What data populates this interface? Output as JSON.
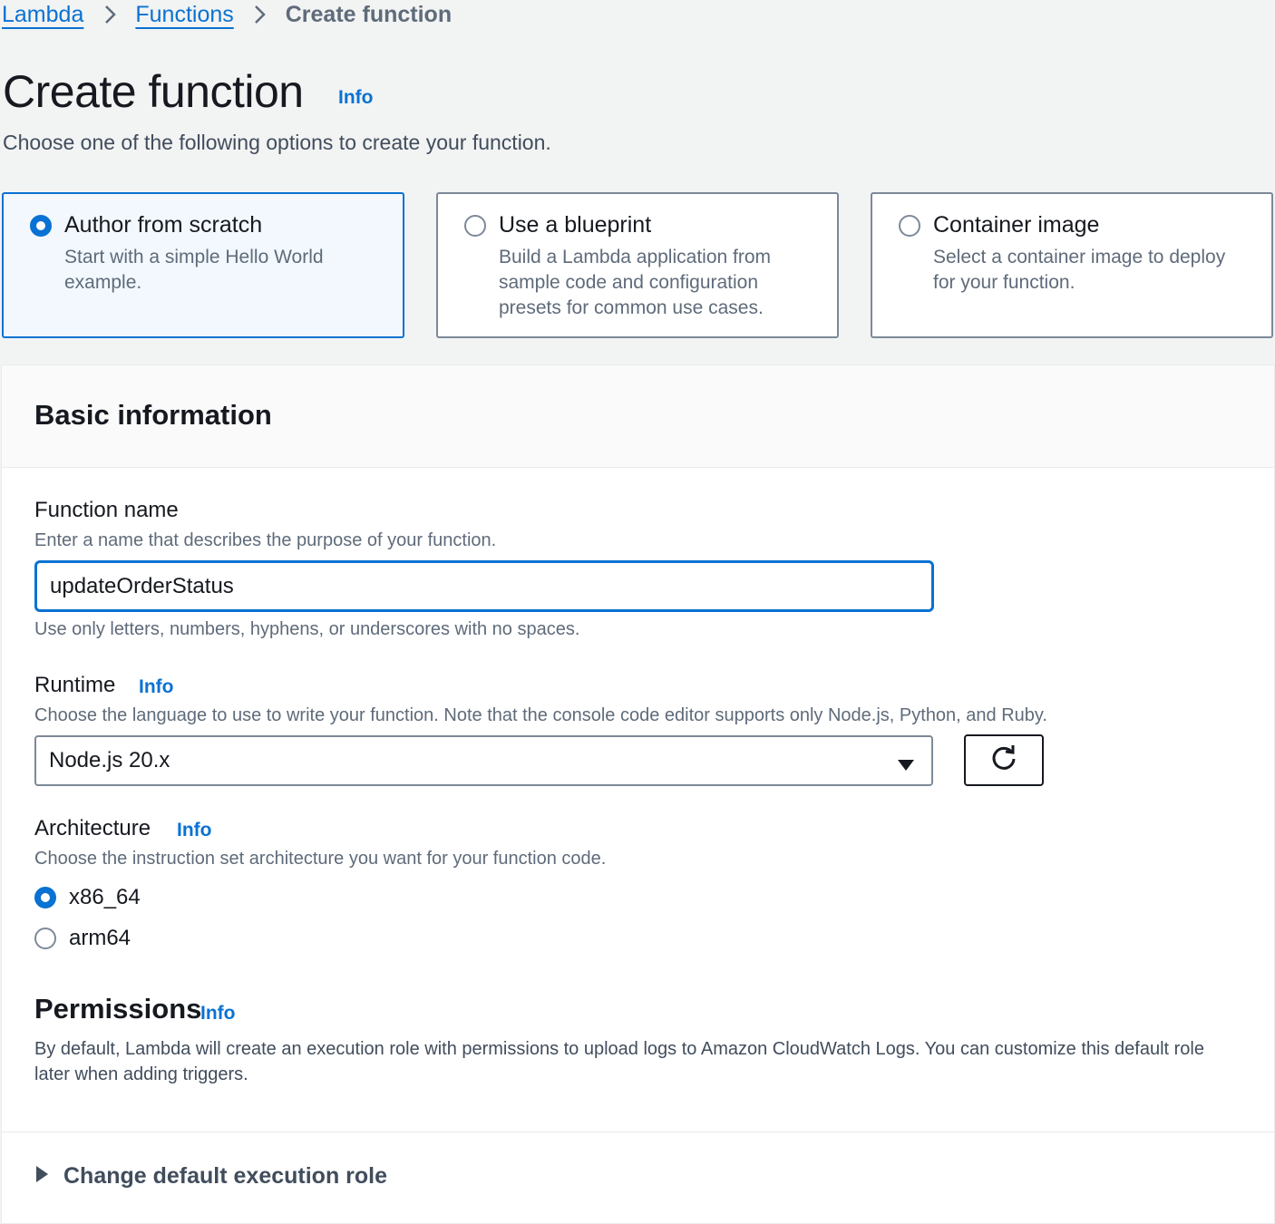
{
  "breadcrumb": {
    "items": [
      {
        "label": "Lambda"
      },
      {
        "label": "Functions"
      }
    ],
    "current": "Create function"
  },
  "page": {
    "title": "Create function",
    "info_label": "Info",
    "description": "Choose one of the following options to create your function."
  },
  "options": [
    {
      "title": "Author from scratch",
      "description": "Start with a simple Hello World example.",
      "selected": true
    },
    {
      "title": "Use a blueprint",
      "description": "Build a Lambda application from sample code and configuration presets for common use cases.",
      "selected": false
    },
    {
      "title": "Container image",
      "description": "Select a container image to deploy for your function.",
      "selected": false
    }
  ],
  "basic_info": {
    "title": "Basic information",
    "function_name": {
      "label": "Function name",
      "description": "Enter a name that describes the purpose of your function.",
      "value": "updateOrderStatus",
      "constraint": "Use only letters, numbers, hyphens, or underscores with no spaces."
    },
    "runtime": {
      "label": "Runtime",
      "info_label": "Info",
      "description": "Choose the language to use to write your function. Note that the console code editor supports only Node.js, Python, and Ruby.",
      "selected": "Node.js 20.x"
    },
    "architecture": {
      "label": "Architecture",
      "info_label": "Info",
      "description": "Choose the instruction set architecture you want for your function code.",
      "options": [
        {
          "label": "x86_64",
          "selected": true
        },
        {
          "label": "arm64",
          "selected": false
        }
      ]
    },
    "permissions": {
      "title": "Permissions",
      "info_label": "Info",
      "description": "By default, Lambda will create an execution role with permissions to upload logs to Amazon CloudWatch Logs. You can customize this default role later when adding triggers."
    },
    "expander_label": "Change default execution role"
  },
  "colors": {
    "link": "#0972d3",
    "selected_bg": "#f2f8fd",
    "page_bg": "#f2f3f3"
  },
  "icons": {
    "breadcrumb_separator": "chevron-right-icon",
    "select_caret": "caret-down-icon",
    "refresh": "refresh-icon",
    "expander": "caret-right-icon"
  }
}
